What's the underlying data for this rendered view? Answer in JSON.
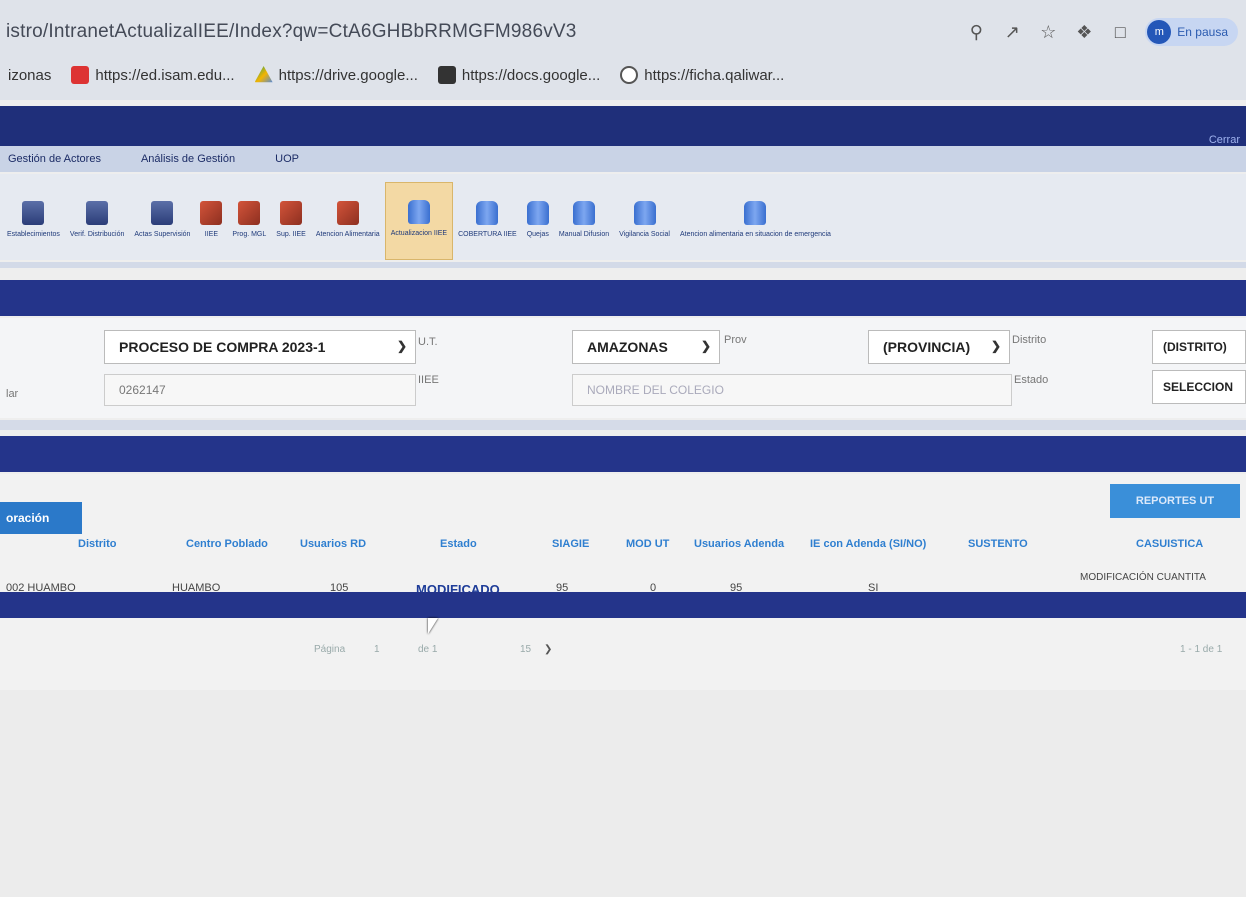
{
  "browser": {
    "url": "istro/IntranetActualizalIEE/Index?qw=CtA6GHBbRRMGFM986vV3",
    "profile_label": "En pausa",
    "bookmarks": [
      {
        "label": "izonas",
        "icon": "bookmark-folder-icon"
      },
      {
        "label": "https://ed.isam.edu...",
        "icon": "site-icon",
        "color": "#d33"
      },
      {
        "label": "https://drive.google...",
        "icon": "drive-icon",
        "color": "#f4b400"
      },
      {
        "label": "https://docs.google...",
        "icon": "docs-icon",
        "color": "#333"
      },
      {
        "label": "https://ficha.qaliwar...",
        "icon": "site-icon",
        "color": "#555"
      }
    ]
  },
  "header": {
    "close_label": "Cerrar"
  },
  "menu": [
    "Gestión de Actores",
    "Análisis de Gestión",
    "UOP"
  ],
  "toolbar": [
    {
      "label": "Establecimientos",
      "icon": "building-icon"
    },
    {
      "label": "Verif. Distribución",
      "icon": "building-icon"
    },
    {
      "label": "Actas Supervisión",
      "icon": "building-icon"
    },
    {
      "label": "IIEE",
      "icon": "books-icon"
    },
    {
      "label": "Prog. MGL",
      "icon": "books-icon"
    },
    {
      "label": "Sup. IIEE",
      "icon": "books-icon"
    },
    {
      "label": "Atencion Alimentaria",
      "icon": "books-icon"
    },
    {
      "label": "Actualizacion IIEE",
      "icon": "database-icon",
      "active": true
    },
    {
      "label": "COBERTURA IIEE",
      "icon": "database-icon"
    },
    {
      "label": "Quejas",
      "icon": "database-icon"
    },
    {
      "label": "Manual Difusion",
      "icon": "database-icon"
    },
    {
      "label": "Vigilancia Social",
      "icon": "database-icon"
    },
    {
      "label": "Atencion alimentaria en situacion de emergencia",
      "icon": "database-icon"
    }
  ],
  "filters": {
    "proceso": "PROCESO DE COMPRA 2023-1",
    "ut_label": "U.T.",
    "ut_value": "AMAZONAS",
    "prov_label": "Prov",
    "prov_value": "(PROVINCIA)",
    "distrito_label": "Distrito",
    "distrito_value": "(DISTRITO)",
    "codigo_label": "lar",
    "codigo_value": "0262147",
    "iiee_label": "IIEE",
    "iiee_placeholder": "NOMBRE DEL COLEGIO",
    "estado_label": "Estado",
    "estado_value": "SELECCION"
  },
  "results": {
    "tab_label": "oración",
    "report_button": "REPORTES UT",
    "columns": [
      "Distrito",
      "Centro Poblado",
      "Usuarios RD",
      "Estado",
      "SIAGIE",
      "MOD UT",
      "Usuarios Adenda",
      "IE con Adenda (SI/NO)",
      "SUSTENTO",
      "CASUISTICA"
    ],
    "row": [
      "002 HUAMBO",
      "HUAMBO",
      "105",
      "MODIFICADO",
      "95",
      "0",
      "95",
      "SI",
      "",
      "MODIFICACIÓN CUANTITA"
    ],
    "pager": {
      "page_label": "Página",
      "page": "1",
      "of_label": "de 1",
      "page_size": "15",
      "summary": "1 - 1 de 1"
    }
  }
}
